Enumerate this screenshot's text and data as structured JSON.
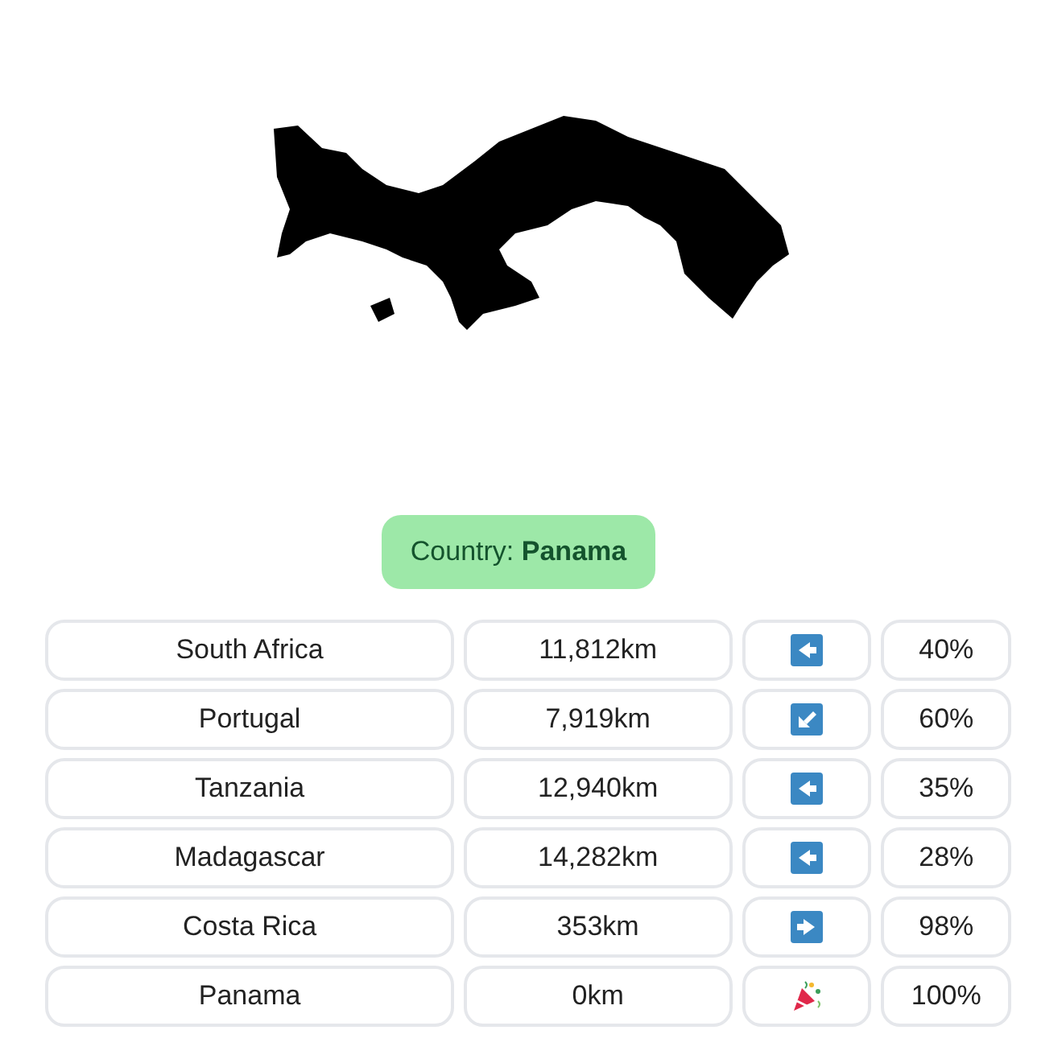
{
  "country_badge": {
    "text": "Country: **Panama**"
  },
  "guesses": [
    {
      "country": "South Africa",
      "distance": "11,812km",
      "kind": "west",
      "proximity": "40%"
    },
    {
      "country": "Portugal",
      "distance": "7,919km",
      "kind": "southwest",
      "proximity": "60%"
    },
    {
      "country": "Tanzania",
      "distance": "12,940km",
      "kind": "west",
      "proximity": "35%"
    },
    {
      "country": "Madagascar",
      "distance": "14,282km",
      "kind": "west",
      "proximity": "28%"
    },
    {
      "country": "Costa Rica",
      "distance": "353km",
      "kind": "east",
      "proximity": "98%"
    },
    {
      "country": "Panama",
      "distance": "0km",
      "kind": "win",
      "proximity": "100%"
    }
  ]
}
